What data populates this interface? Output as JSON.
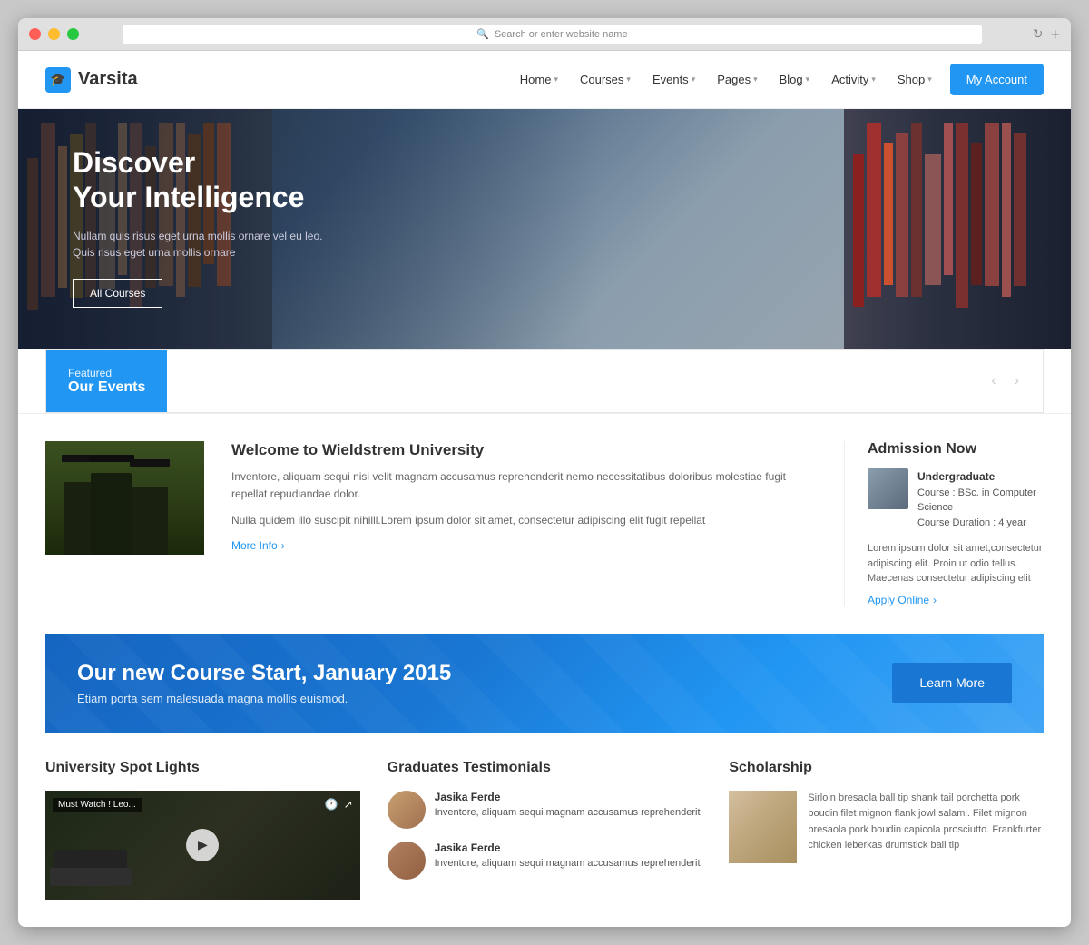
{
  "browser": {
    "address_placeholder": "Search or enter website name"
  },
  "logo": {
    "name": "Varsita",
    "icon": "🎓"
  },
  "nav": {
    "items": [
      {
        "label": "Home",
        "has_dropdown": true
      },
      {
        "label": "Courses",
        "has_dropdown": true
      },
      {
        "label": "Events",
        "has_dropdown": true
      },
      {
        "label": "Pages",
        "has_dropdown": true
      },
      {
        "label": "Blog",
        "has_dropdown": true
      },
      {
        "label": "Activity",
        "has_dropdown": true
      },
      {
        "label": "Shop",
        "has_dropdown": true
      }
    ],
    "my_account": "My Account"
  },
  "hero": {
    "title_line1": "Discover",
    "title_line2": "Your Intelligence",
    "subtitle": "Nullam quis risus eget urna mollis ornare vel eu leo. Quis risus eget urna mollis ornare",
    "cta_button": "All Courses"
  },
  "featured_events": {
    "label": "Featured",
    "title": "Our Events"
  },
  "welcome": {
    "title": "Welcome to Wieldstrem University",
    "body1": "Inventore, aliquam sequi nisi velit magnam accusamus reprehenderit nemo necessitatibus doloribus molestiae fugit repellat repudiandae dolor.",
    "body2": "Nulla quidem illo suscipit nihilll.Lorem ipsum dolor sit amet, consectetur adipiscing elit fugit repellat",
    "more_info": "More Info"
  },
  "admission": {
    "title": "Admission Now",
    "degree": "Undergraduate",
    "course": "Course : BSc. in Computer Science",
    "duration": "Course Duration : 4 year",
    "body": "Lorem ipsum dolor sit amet,consectetur adipiscing elit. Proin ut odio tellus. Maecenas consectetur adipiscing elit",
    "apply_link": "Apply Online"
  },
  "course_banner": {
    "title": "Our new Course Start, January 2015",
    "subtitle": "Etiam porta sem malesuada magna mollis euismod.",
    "cta": "Learn More"
  },
  "spotlight": {
    "title": "University Spot Lights",
    "video_label": "Must Watch ! Leo..."
  },
  "testimonials": {
    "title": "Graduates Testimonials",
    "items": [
      {
        "name": "Jasika Ferde",
        "text": "Inventore, aliquam sequi magnam accusamus reprehenderit"
      },
      {
        "name": "Jasika Ferde",
        "text": "Inventore, aliquam sequi magnam accusamus reprehenderit"
      }
    ]
  },
  "scholarship": {
    "title": "Scholarship",
    "text": "Sirloin bresaola ball tip shank tail porchetta pork boudin filet mignon flank jowl salami. Filet mignon bresaola pork boudin capicola prosciutto. Frankfurter chicken leberkas drumstick ball tip"
  }
}
